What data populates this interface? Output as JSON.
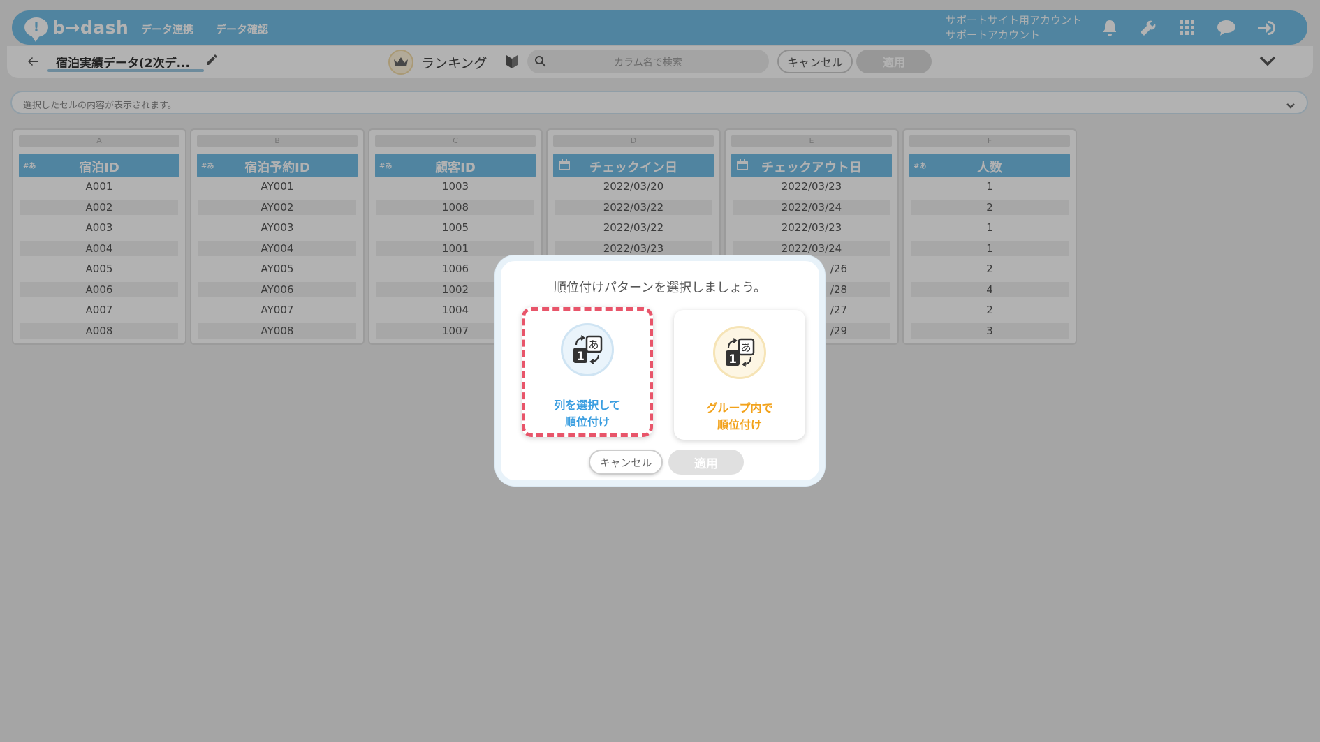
{
  "header": {
    "logo_text": "b→dash",
    "logo_mark": "!",
    "nav_items": [
      "データ連携",
      "データ確認"
    ],
    "account_line1": "サポートサイト用アカウント",
    "account_line2": "サポートアカウント",
    "icons": [
      "bell-icon",
      "wrench-icon",
      "grid-icon",
      "chat-icon",
      "logout-icon"
    ],
    "accent_color": "#73bde6"
  },
  "toolbar": {
    "back_icon": "arrow-left-icon",
    "file_title": "宿泊実績データ(2次デ...",
    "ranking_label": "ランキング",
    "search_placeholder": "カラム名で検索",
    "cancel_label": "キャンセル",
    "apply_label": "適用"
  },
  "cellbar": {
    "placeholder": "選択したセルの内容が表示されます。"
  },
  "columns": [
    {
      "letter": "A",
      "type": "#あ",
      "name": "宿泊ID",
      "values": [
        "A001",
        "A002",
        "A003",
        "A004",
        "A005",
        "A006",
        "A007",
        "A008"
      ]
    },
    {
      "letter": "B",
      "type": "#あ",
      "name": "宿泊予約ID",
      "values": [
        "AY001",
        "AY002",
        "AY003",
        "AY004",
        "AY005",
        "AY006",
        "AY007",
        "AY008"
      ]
    },
    {
      "letter": "C",
      "type": "#あ",
      "name": "顧客ID",
      "values": [
        "1003",
        "1008",
        "1005",
        "1001",
        "1006",
        "1002",
        "1004",
        "1007"
      ]
    },
    {
      "letter": "D",
      "type": "calendar",
      "name": "チェックイン日",
      "values": [
        "2022/03/20",
        "2022/03/22",
        "2022/03/22",
        "2022/03/23",
        "",
        "",
        "",
        ""
      ]
    },
    {
      "letter": "E",
      "type": "calendar",
      "name": "チェックアウト日",
      "values": [
        "2022/03/23",
        "2022/03/24",
        "2022/03/23",
        "2022/03/24",
        "/26",
        "/28",
        "/27",
        "/29"
      ]
    },
    {
      "letter": "F",
      "type": "#あ",
      "name": "人数",
      "values": [
        "1",
        "2",
        "1",
        "1",
        "2",
        "4",
        "2",
        "3"
      ]
    }
  ],
  "modal": {
    "title": "順位付けパターンを選択しましょう。",
    "option1_line1": "列を選択して",
    "option1_line2": "順位付け",
    "option1_color": "#3a9ee0",
    "option2_line1": "グループ内で",
    "option2_line2": "順位付け",
    "option2_color": "#f2a21b",
    "selected_border_color": "#e8556a",
    "cancel_label": "キャンセル",
    "apply_label": "適用"
  }
}
